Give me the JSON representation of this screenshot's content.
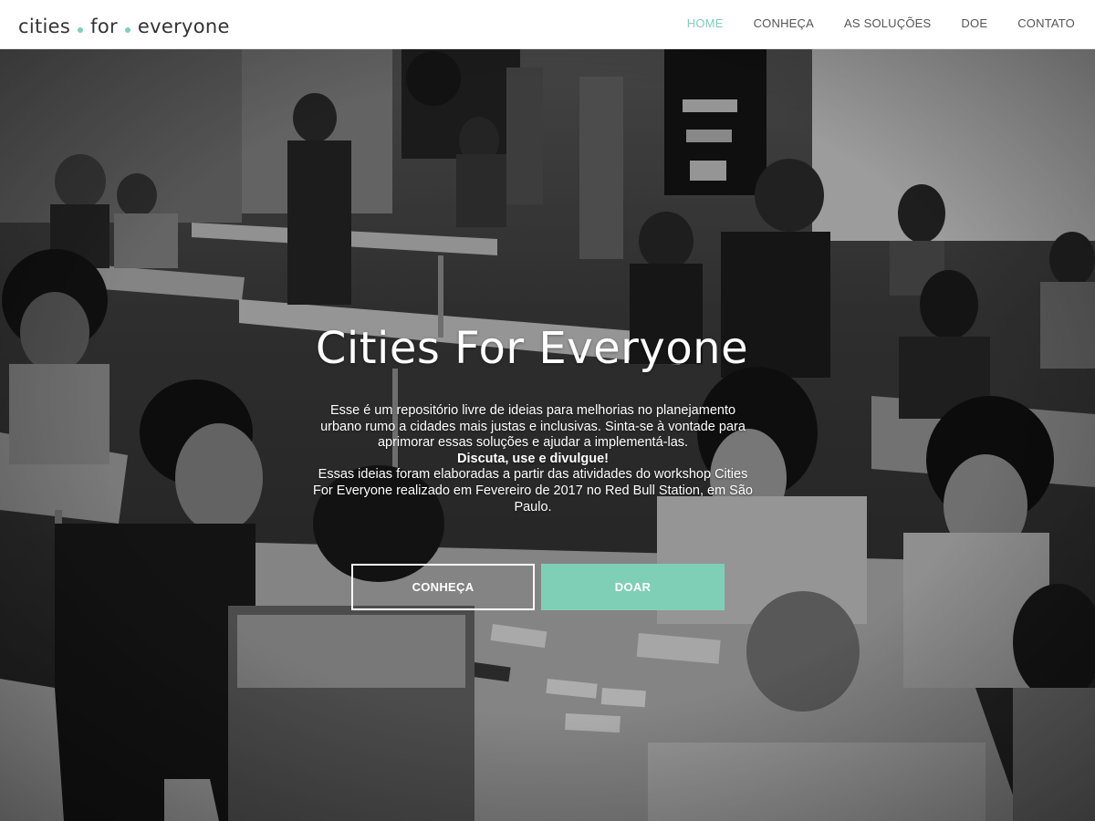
{
  "logo": {
    "part1": "cities",
    "part2": "for",
    "part3": "everyone",
    "dot_color": "#7fcfb7"
  },
  "nav": {
    "items": [
      {
        "label": "HOME",
        "active": true
      },
      {
        "label": "CONHEÇA",
        "active": false
      },
      {
        "label": "AS SOLUÇÕES",
        "active": false
      },
      {
        "label": "DOE",
        "active": false
      },
      {
        "label": "CONTATO",
        "active": false
      }
    ]
  },
  "hero": {
    "title": "Cities For Everyone",
    "line1": "Esse é um repositório livre de ideias para melhorias no planejamento urbano rumo a cidades mais justas e inclusivas. Sinta-se à vontade para aprimorar essas soluções e ajudar a implementá-las.",
    "line2": "Discuta, use e divulgue!",
    "line3": "Essas ideias foram elaboradas a partir das atividades do workshop Cities For Everyone realizado em Fevereiro de 2017 no Red Bull Station, em São Paulo.",
    "button_primary": "CONHEÇA",
    "button_secondary": "DOAR"
  },
  "colors": {
    "accent": "#7fcfb7",
    "nav_text": "#555555",
    "logo_text": "#333333"
  }
}
